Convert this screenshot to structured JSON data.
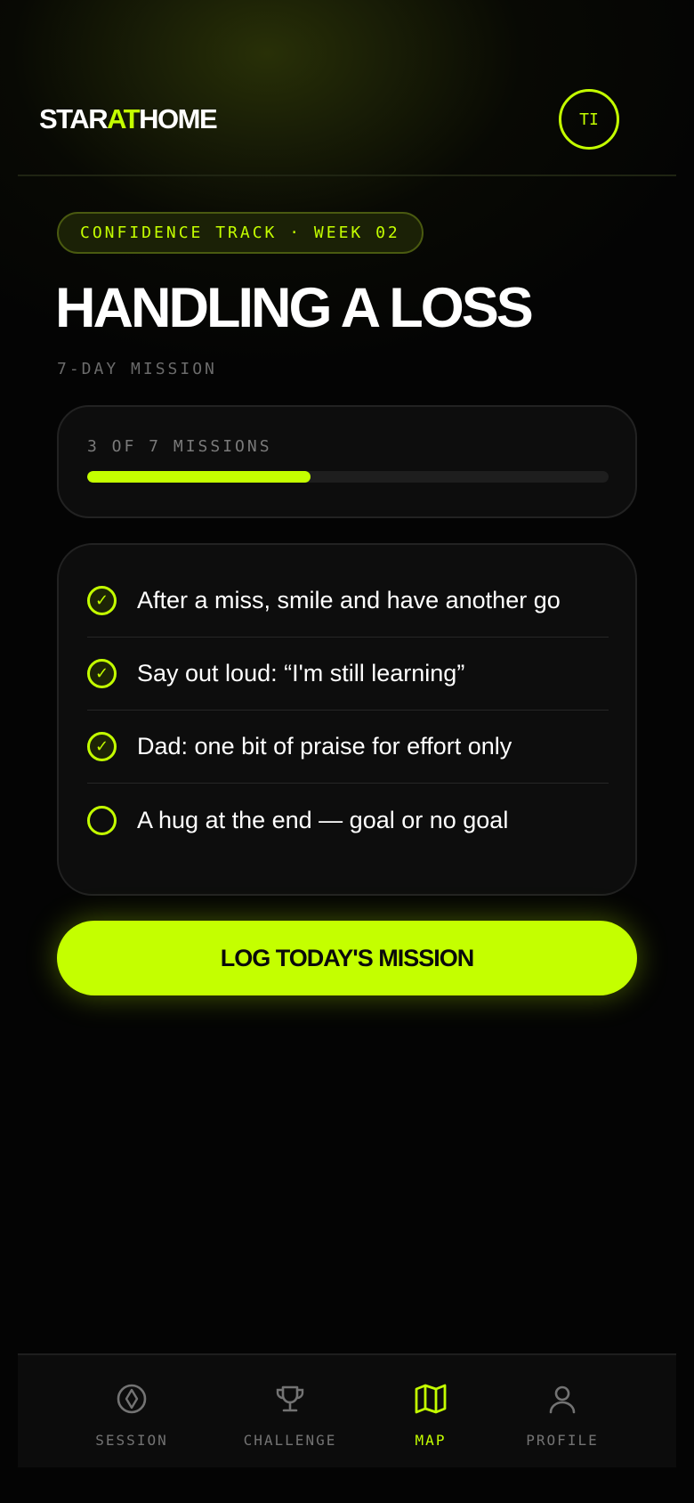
{
  "brand": {
    "logo_part1": "STAR",
    "logo_part2": "AT",
    "logo_part3": "HOME",
    "accent_color": "#c4ff00"
  },
  "header": {
    "avatar_initials": "TI"
  },
  "track": {
    "pill": "CONFIDENCE TRACK · WEEK 02"
  },
  "mission": {
    "title": "HANDLING A LOSS",
    "subtitle": "7-DAY MISSION"
  },
  "progress": {
    "label": "3 OF 7 MISSIONS",
    "completed": 3,
    "total": 7,
    "fraction": 0.4286
  },
  "tasks": [
    {
      "text": "After a miss, smile and have another go",
      "done": true
    },
    {
      "text": "Say out loud: “I'm still learning”",
      "done": true
    },
    {
      "text": "Dad: one bit of praise for effort only",
      "done": true
    },
    {
      "text": "A hug at the end — goal or no goal",
      "done": false
    }
  ],
  "cta": {
    "label": "LOG TODAY'S MISSION"
  },
  "nav": {
    "items": [
      {
        "label": "SESSION",
        "icon": "compass-icon",
        "active": false
      },
      {
        "label": "CHALLENGE",
        "icon": "trophy-icon",
        "active": false
      },
      {
        "label": "MAP",
        "icon": "map-icon",
        "active": true
      },
      {
        "label": "PROFILE",
        "icon": "user-icon",
        "active": false
      }
    ]
  }
}
